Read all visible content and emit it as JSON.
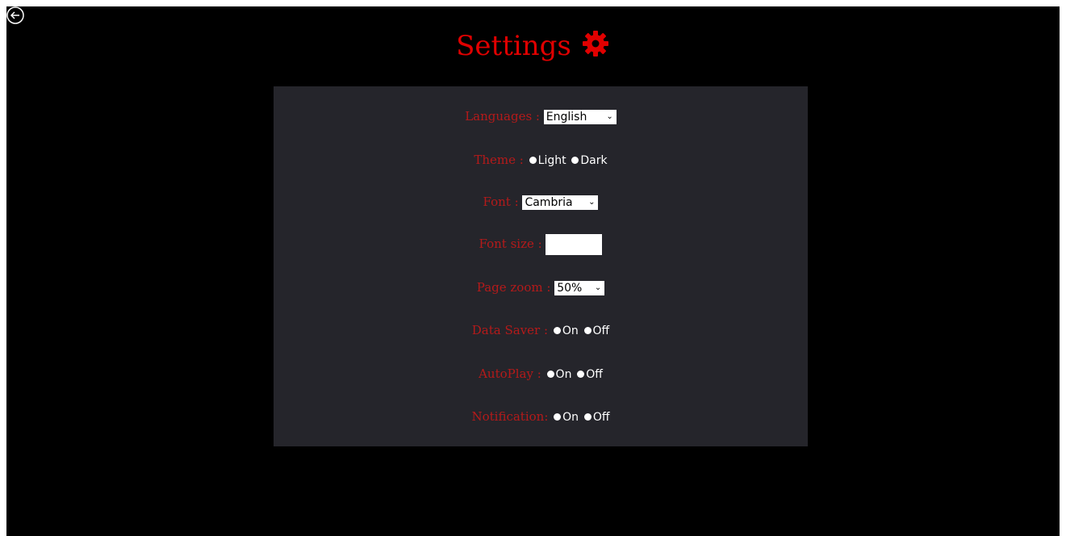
{
  "header": {
    "title": "Settings"
  },
  "icons": {
    "back": "circle-arrow-left-icon",
    "gear": "gear-icon"
  },
  "colors": {
    "accent": "#e00000",
    "label": "#b51a1a",
    "panel": "#25252b",
    "background": "#000000"
  },
  "settings": {
    "languages": {
      "label": "Languages :",
      "value": "English"
    },
    "theme": {
      "label": "Theme :",
      "options": [
        "Light",
        "Dark"
      ]
    },
    "font": {
      "label": "Font :",
      "value": "Cambria"
    },
    "font_size": {
      "label": "Font size :",
      "value": ""
    },
    "page_zoom": {
      "label": "Page zoom :",
      "value": "50%"
    },
    "data_saver": {
      "label": "Data Saver :",
      "options": [
        "On",
        "Off"
      ]
    },
    "autoplay": {
      "label": "AutoPlay :",
      "options": [
        "On",
        "Off"
      ]
    },
    "notification": {
      "label": "Notification:",
      "options": [
        "On",
        "Off"
      ]
    }
  }
}
